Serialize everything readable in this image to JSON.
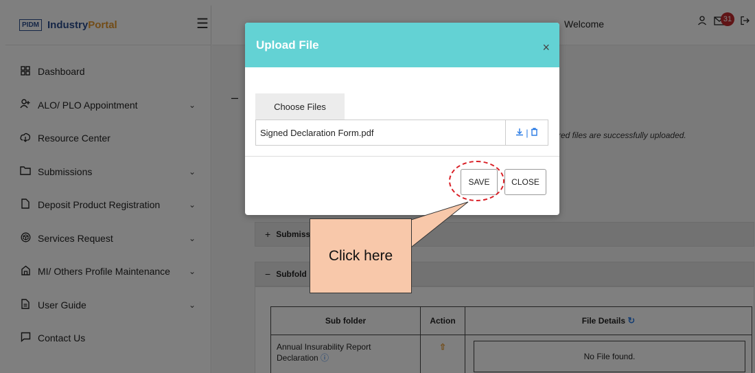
{
  "sidebar": {
    "logo_badge": "PIDM",
    "brand_primary": "Industry",
    "brand_secondary": "Portal",
    "menu_icon": "hamburger-icon",
    "items": [
      {
        "label": "Dashboard",
        "icon": "grid-icon",
        "has_children": false
      },
      {
        "label": "ALO/ PLO Appointment",
        "icon": "add-user-icon",
        "has_children": true
      },
      {
        "label": "Resource Center",
        "icon": "cloud-download-icon",
        "has_children": false
      },
      {
        "label": "Submissions",
        "icon": "folder-icon",
        "has_children": true
      },
      {
        "label": "Deposit Product Registration",
        "icon": "file-icon",
        "has_children": true
      },
      {
        "label": "Services Request",
        "icon": "cube-icon",
        "has_children": true
      },
      {
        "label": "MI/ Others Profile Maintenance",
        "icon": "building-icon",
        "has_children": true
      },
      {
        "label": "User Guide",
        "icon": "document-icon",
        "has_children": true
      },
      {
        "label": "Contact Us",
        "icon": "chat-icon",
        "has_children": false
      }
    ]
  },
  "header": {
    "welcome": "Welcome",
    "notification_count": "31"
  },
  "main": {
    "uploaded_note": "red files are successfully uploaded.",
    "panels": [
      {
        "sign": "+",
        "label": "Submiss"
      },
      {
        "sign": "−",
        "label": "Subfold"
      }
    ],
    "table": {
      "headers": [
        "Sub folder",
        "Action",
        "File Details"
      ],
      "rows": [
        {
          "subfolder": "Annual Insurability Report Declaration",
          "file_details": "No File found."
        }
      ]
    }
  },
  "modal": {
    "title": "Upload File",
    "close_symbol": "×",
    "choose_files_label": "Choose Files",
    "file_name": "Signed Declaration Form.pdf",
    "save_label": "SAVE",
    "close_label": "CLOSE"
  },
  "annotation": {
    "callout_text": "Click here",
    "ring_color": "#d91f26",
    "callout_color": "#f8c8aa"
  },
  "colors": {
    "modal_header": "#63d2d4",
    "brand_blue": "#2b4c8c",
    "brand_orange": "#e5992f",
    "badge_red": "#c0282d",
    "link_blue": "#2a7be4"
  }
}
